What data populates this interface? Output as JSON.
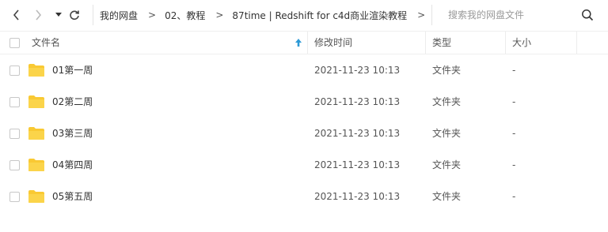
{
  "toolbar": {
    "breadcrumb": [
      "我的网盘",
      "02、教程",
      "87time | Redshift for c4d商业渲染教程"
    ],
    "separator": ">",
    "search_placeholder": "搜索我的网盘文件"
  },
  "icons": {
    "back": "chevron-left-icon",
    "forward": "chevron-right-icon",
    "history": "dropdown-caret-icon",
    "refresh": "refresh-icon",
    "search": "search-icon",
    "sort": "sort-ascending-icon",
    "folder": "folder-icon"
  },
  "colors": {
    "folder": "#f9c933",
    "sort_arrow": "#2d9ad6"
  },
  "table": {
    "columns": {
      "name": "文件名",
      "modified": "修改时间",
      "type": "类型",
      "size": "大小"
    },
    "rows": [
      {
        "name": "01第一周",
        "modified": "2021-11-23 10:13",
        "type": "文件夹",
        "size": "-"
      },
      {
        "name": "02第二周",
        "modified": "2021-11-23 10:13",
        "type": "文件夹",
        "size": "-"
      },
      {
        "name": "03第三周",
        "modified": "2021-11-23 10:13",
        "type": "文件夹",
        "size": "-"
      },
      {
        "name": "04第四周",
        "modified": "2021-11-23 10:13",
        "type": "文件夹",
        "size": "-"
      },
      {
        "name": "05第五周",
        "modified": "2021-11-23 10:13",
        "type": "文件夹",
        "size": "-"
      }
    ]
  }
}
